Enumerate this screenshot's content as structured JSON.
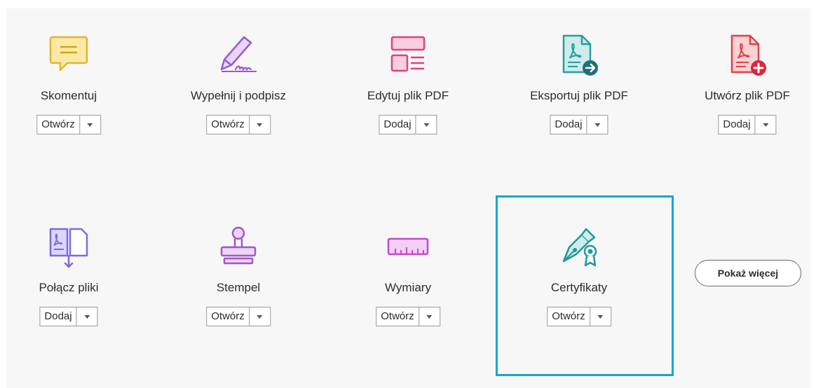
{
  "tools": [
    {
      "id": "comment",
      "label": "Skomentuj",
      "action": "Otwórz",
      "icon": "comment-icon",
      "color": "#e8c13a"
    },
    {
      "id": "fill-sign",
      "label": "Wypełnij i podpisz",
      "action": "Otwórz",
      "icon": "fill-sign-icon",
      "color": "#9b59d0"
    },
    {
      "id": "edit-pdf",
      "label": "Edytuj plik PDF",
      "action": "Dodaj",
      "icon": "edit-pdf-icon",
      "color": "#e2407f"
    },
    {
      "id": "export-pdf",
      "label": "Eksportuj plik PDF",
      "action": "Dodaj",
      "icon": "export-pdf-icon",
      "color": "#2a9d9c"
    },
    {
      "id": "create-pdf",
      "label": "Utwórz plik PDF",
      "action": "Dodaj",
      "icon": "create-pdf-icon",
      "color": "#e0434a"
    },
    {
      "id": "combine",
      "label": "Połącz pliki",
      "action": "Dodaj",
      "icon": "combine-files-icon",
      "color": "#7b6be0"
    },
    {
      "id": "stamp",
      "label": "Stempel",
      "action": "Otwórz",
      "icon": "stamp-icon",
      "color": "#a456c8"
    },
    {
      "id": "measure",
      "label": "Wymiary",
      "action": "Otwórz",
      "icon": "ruler-icon",
      "color": "#c04cc8"
    },
    {
      "id": "certificates",
      "label": "Certyfikaty",
      "action": "Otwórz",
      "icon": "certificate-pen-icon",
      "color": "#1f9a98",
      "highlighted": true
    }
  ],
  "more_button": "Pokaż więcej",
  "highlight_color": "#1aa3d6"
}
